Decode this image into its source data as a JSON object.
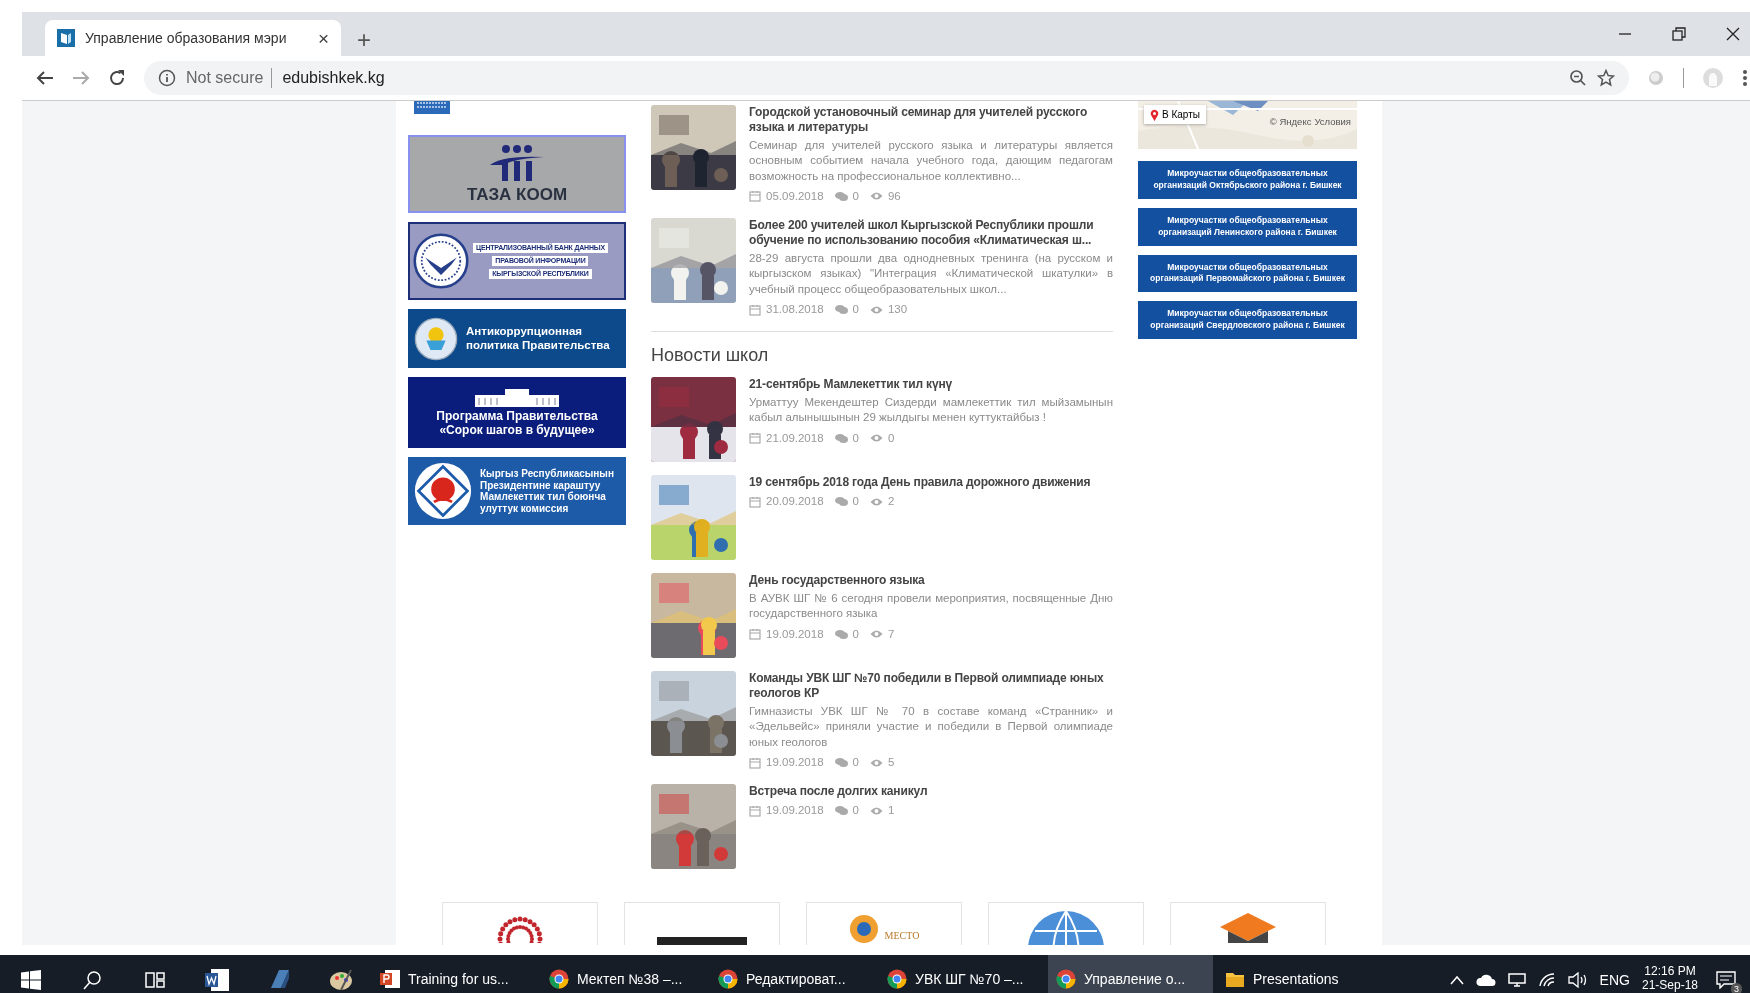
{
  "browser": {
    "tab_title": "Управление образования мэри",
    "close": "×",
    "new_tab": "+",
    "security": "Not secure",
    "url": "edubishkek.kg"
  },
  "left_banners": [
    {
      "kind": "partial"
    },
    {
      "kind": "taza",
      "lines": [
        "ТАЗА КООМ"
      ]
    },
    {
      "kind": "bank",
      "lines": [
        "ЦЕНТРАЛИЗОВАННЫЙ БАНК ДАННЫХ",
        "ПРАВОВОЙ ИНФОРМАЦИИ",
        "КЫРГЫЗСКОЙ РЕСПУБЛИКИ"
      ]
    },
    {
      "kind": "anticorruption",
      "lines": [
        "Антикоррупционная",
        "политика Правительства"
      ]
    },
    {
      "kind": "program",
      "lines": [
        "Программа Правительства",
        "«Сорок шагов в будущее»"
      ]
    },
    {
      "kind": "language",
      "lines": [
        "Кыргыз Республикасынын",
        "Президентине караштуу",
        "Мамлекеттик тил боюнча",
        "улуттук комиссия"
      ]
    }
  ],
  "news": [
    {
      "title": "Городской установочный семинар для учителей русского языка и литературы",
      "excerpt": "Семинар для учителей русского языка и литературы является основным событием начала учебного года, дающим педагогам возможность на профессиональное коллективно...",
      "date": "05.09.2018",
      "comments": "0",
      "views": "96"
    },
    {
      "title": "Более 200 учителей школ Кыргызской Республики прошли обучение по использованию пособия «Климатическая ш...",
      "excerpt": "28-29 августа прошли два однодневных тренинга (на русском и кыргызском языках) \"Интеграция «Климатической шкатулки» в учебный процесс общеобразовательных школ...",
      "date": "31.08.2018",
      "comments": "0",
      "views": "130"
    }
  ],
  "school_news_heading": "Новости школ",
  "school_news": [
    {
      "title": "21-сентябрь Мамлекеттик тил күнү",
      "excerpt": "Урматтуу Мекендештер Сиздерди мамлекеттик тил мыйзамынын кабыл алынышынын 29 жылдыгы менен куттуктайбыз !",
      "date": "21.09.2018",
      "comments": "0",
      "views": "0"
    },
    {
      "title": "19 сентябрь 2018 года День правила дорожного движения",
      "date": "20.09.2018",
      "comments": "0",
      "views": "2"
    },
    {
      "title": "День государственного языка",
      "excerpt": "В АУВК ШГ № 6 сегодня провели мероприятия, посвященные Дню государственного языка",
      "date": "19.09.2018",
      "comments": "0",
      "views": "7"
    },
    {
      "title": "Команды УВК ШГ №70 победили в Первой олимпиаде юных геологов КР",
      "excerpt": "Гимназисты УВК ШГ № 70 в составе команд «Странник» и «Эдельвейс» приняли участие и победили в Первой олимпиаде юных геологов",
      "date": "19.09.2018",
      "comments": "0",
      "views": "5"
    },
    {
      "title": "Встреча после долгих каникул",
      "date": "19.09.2018",
      "comments": "0",
      "views": "1"
    }
  ],
  "map": {
    "button": "В Карты",
    "copyright": "© Яндекс",
    "terms": "Условия"
  },
  "district_links": [
    "Микроучастки общеобразовательных организаций Октябрьского района г. Бишкек",
    "Микроучастки общеобразовательных организаций Ленинского района г. Бишкек",
    "Микроучастки общеобразовательных организаций Первомайского района г. Бишкек",
    "Микроучастки общеобразовательных организаций Свердловского района г. Бишкек"
  ],
  "partners": [
    {
      "kind": "dots"
    },
    {
      "kind": "wordmark"
    },
    {
      "kind": "place",
      "text": "МЕСТО"
    },
    {
      "kind": "globe"
    },
    {
      "kind": "house"
    }
  ],
  "taskbar": {
    "pinned": [
      {
        "kind": "word"
      },
      {
        "kind": "app"
      },
      {
        "kind": "paint"
      }
    ],
    "windows": [
      {
        "kind": "powerpoint",
        "label": "Training for us...",
        "selected": false
      },
      {
        "kind": "chrome",
        "label": "Мектеп №38 –...",
        "selected": false
      },
      {
        "kind": "chrome",
        "label": "Редактироват...",
        "selected": false
      },
      {
        "kind": "chrome",
        "label": "УВК ШГ №70 –...",
        "selected": false
      },
      {
        "kind": "chrome",
        "label": "Управление о...",
        "selected": true
      },
      {
        "kind": "folder",
        "label": "Presentations",
        "selected": false
      }
    ],
    "language": "ENG",
    "time": "12:16 PM",
    "date": "21-Sep-18",
    "notifications": "3"
  }
}
